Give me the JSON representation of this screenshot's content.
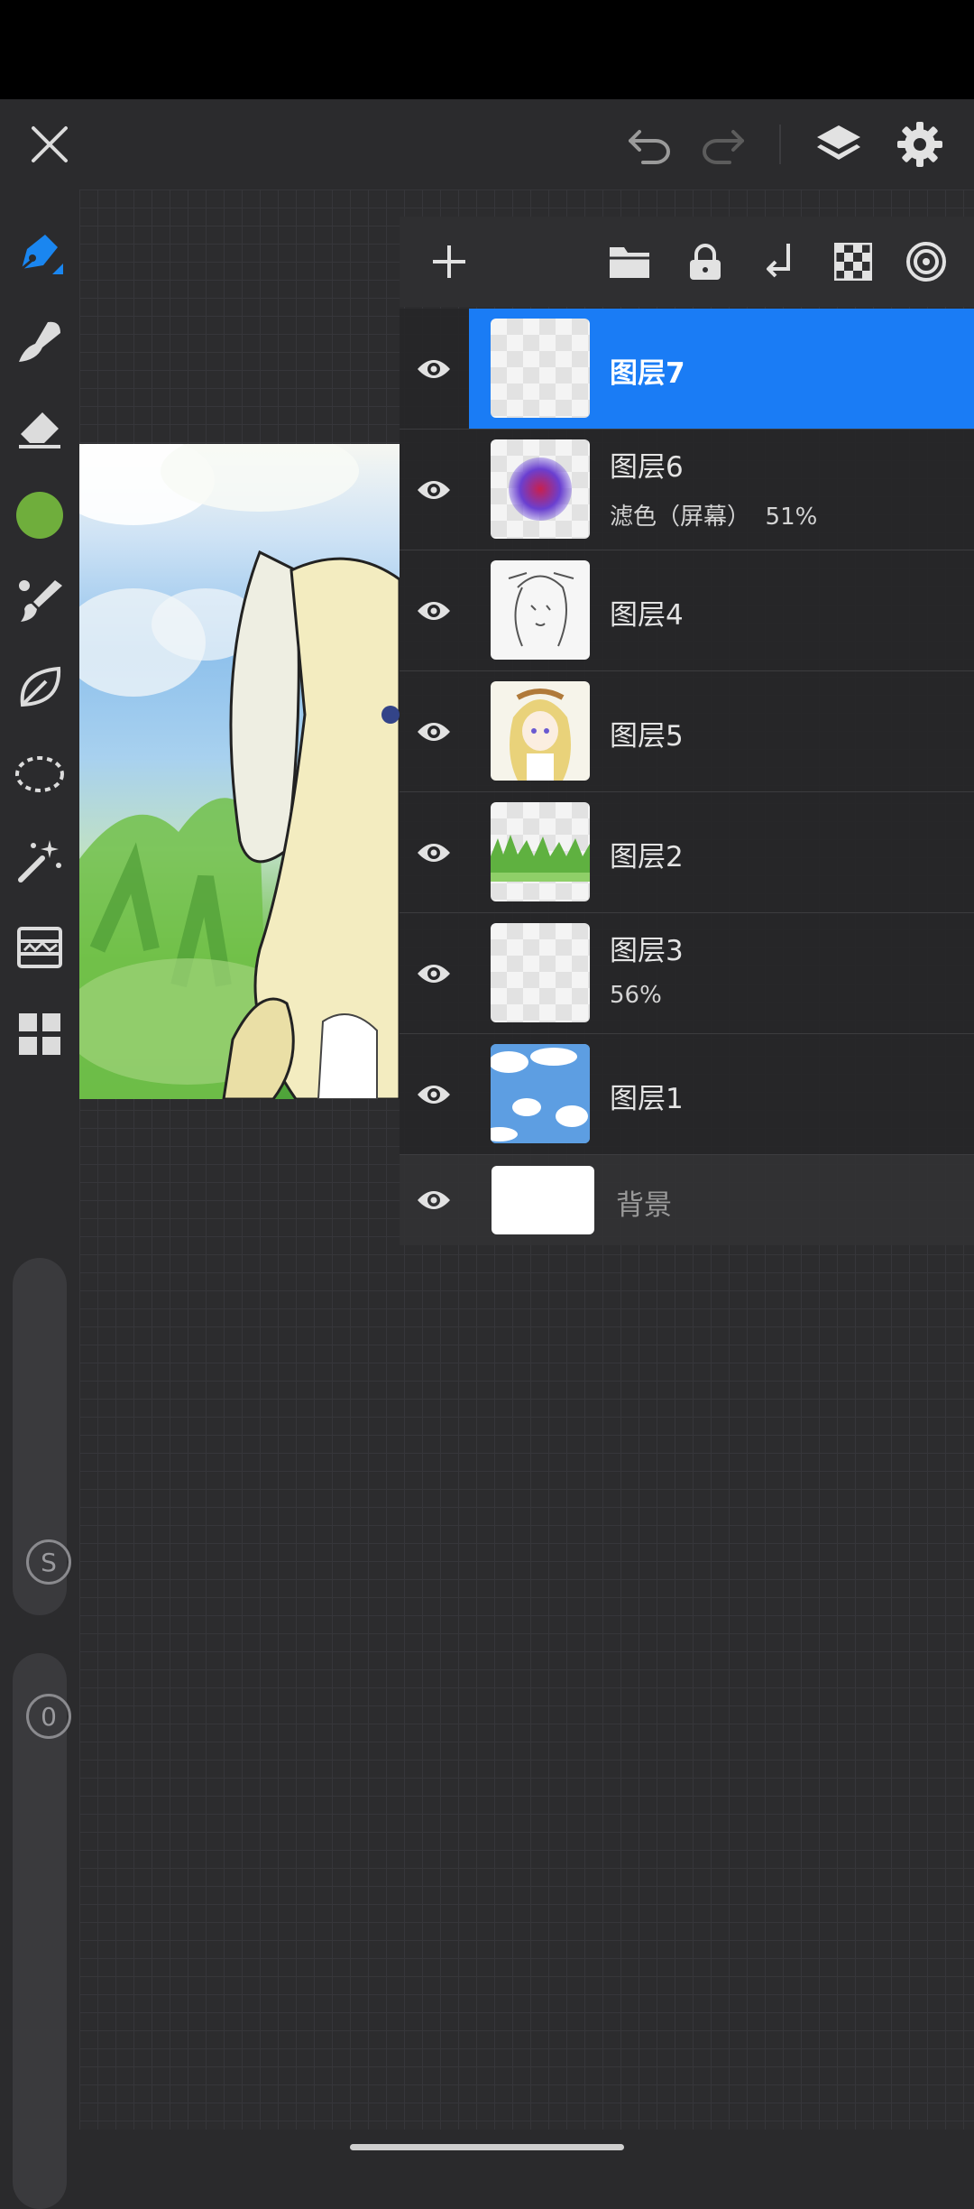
{
  "toolbar": {
    "icons": [
      "close-icon",
      "undo-icon",
      "redo-icon",
      "layers-icon",
      "settings-icon"
    ]
  },
  "tools": {
    "items": [
      "brush-pen-icon",
      "smudge-icon",
      "eraser-icon",
      "color-swatch",
      "paint-brush-icon",
      "leaf-shape-icon",
      "lasso-select-icon",
      "magic-wand-icon",
      "adjustments-icon",
      "gallery-grid-icon"
    ],
    "current_color": "#6fae3c"
  },
  "sliders": {
    "size_badge": "S",
    "opacity_badge": "0"
  },
  "layers_toolbar": {
    "icons": [
      "add-layer-icon",
      "folder-icon",
      "lock-icon",
      "merge-down-icon",
      "transparency-icon",
      "blend-target-icon"
    ]
  },
  "layers": [
    {
      "name": "图层7",
      "sub": "",
      "selected": true
    },
    {
      "name": "图层6",
      "sub": "滤色（屏幕）  51%",
      "selected": false
    },
    {
      "name": "图层4",
      "sub": "",
      "selected": false
    },
    {
      "name": "图层5",
      "sub": "",
      "selected": false
    },
    {
      "name": "图层2",
      "sub": "",
      "selected": false
    },
    {
      "name": "图层3",
      "sub": "56%",
      "selected": false
    },
    {
      "name": "图层1",
      "sub": "",
      "selected": false
    }
  ],
  "background_layer": {
    "name": "背景"
  },
  "colors": {
    "accent": "#1a7cf5",
    "panel": "#2f2f31",
    "background": "#2a2a2c"
  }
}
